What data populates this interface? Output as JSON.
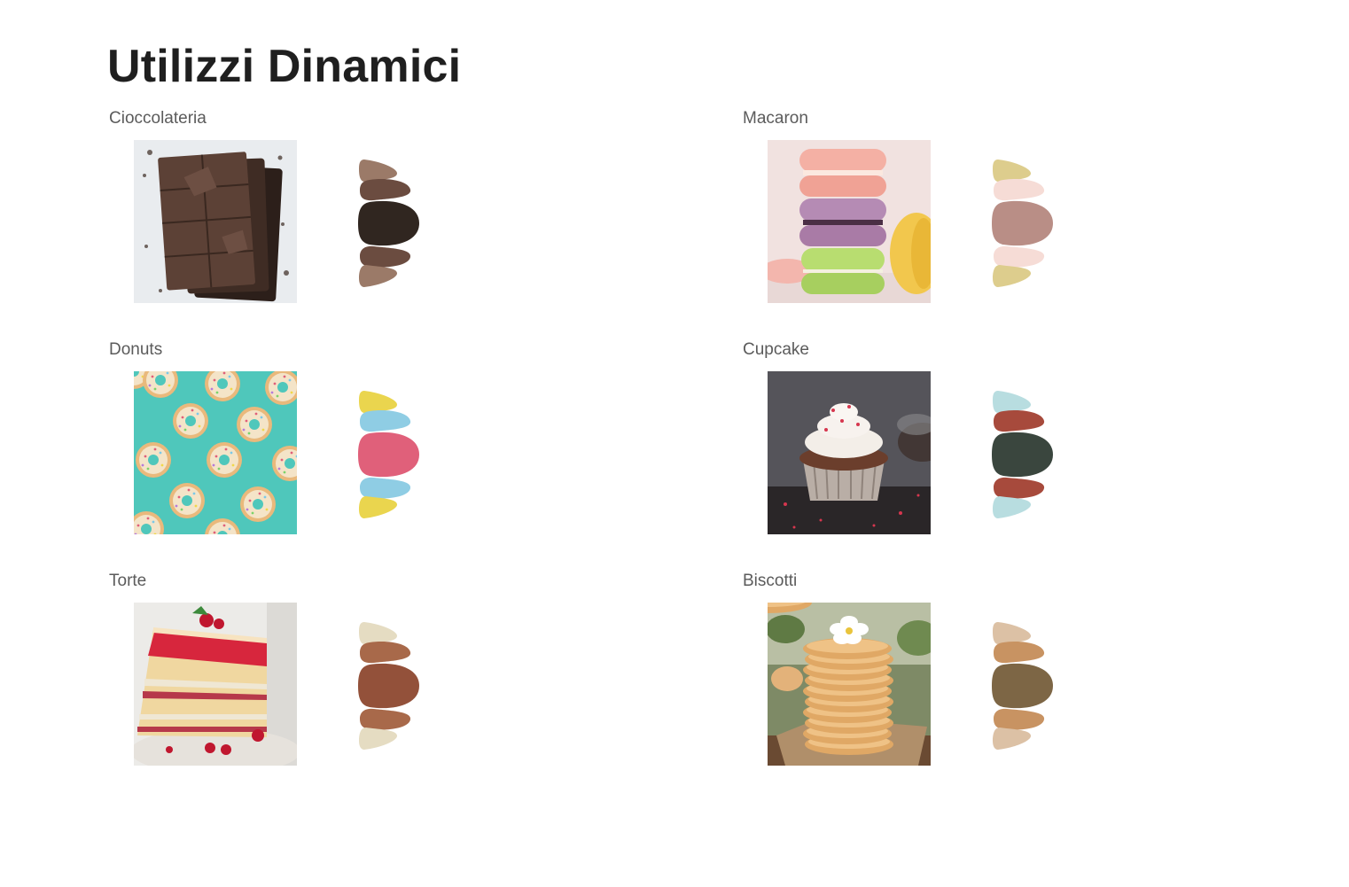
{
  "page": {
    "title": "Utilizzi Dinamici"
  },
  "categories": [
    {
      "key": "cioccolateria",
      "label": "Cioccolateria",
      "photo": "chocolate-bar-photo",
      "palette": [
        "#9b7a68",
        "#6b4c40",
        "#302620"
      ]
    },
    {
      "key": "macaron",
      "label": "Macaron",
      "photo": "macaron-stack-photo",
      "palette": [
        "#ddcd8d",
        "#f6dcd6",
        "#b98e86"
      ]
    },
    {
      "key": "donuts",
      "label": "Donuts",
      "photo": "donuts-photo",
      "palette": [
        "#ead54e",
        "#8fcde4",
        "#e0607a"
      ]
    },
    {
      "key": "cupcake",
      "label": "Cupcake",
      "photo": "cupcake-photo",
      "palette": [
        "#b8dde0",
        "#a74a3c",
        "#3a463e"
      ]
    },
    {
      "key": "torte",
      "label": "Torte",
      "photo": "layer-cake-photo",
      "palette": [
        "#e5dcc2",
        "#a8694a",
        "#93513a"
      ]
    },
    {
      "key": "biscotti",
      "label": "Biscotti",
      "photo": "biscuits-stack-photo",
      "palette": [
        "#dcc1a5",
        "#c89362",
        "#7d6645"
      ]
    }
  ]
}
